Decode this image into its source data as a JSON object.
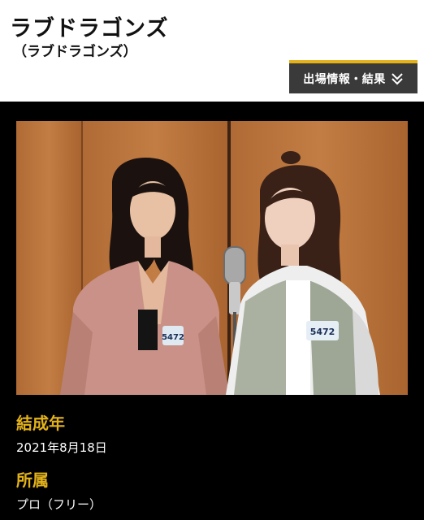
{
  "header": {
    "title": "ラブドラゴンズ",
    "subtitle": "（ラブドラゴンズ）",
    "results_button": "出場情報・結果"
  },
  "badges": {
    "left": "5472",
    "right": "5472"
  },
  "info": [
    {
      "label": "結成年",
      "value": "2021年8月18日"
    },
    {
      "label": "所属",
      "value": "プロ（フリー）"
    }
  ],
  "colors": {
    "accent": "#e3b21a",
    "button_bg": "#3a3a3a",
    "dark_bg": "#000000"
  },
  "icons": {
    "results": "double-chevron-down-icon"
  }
}
